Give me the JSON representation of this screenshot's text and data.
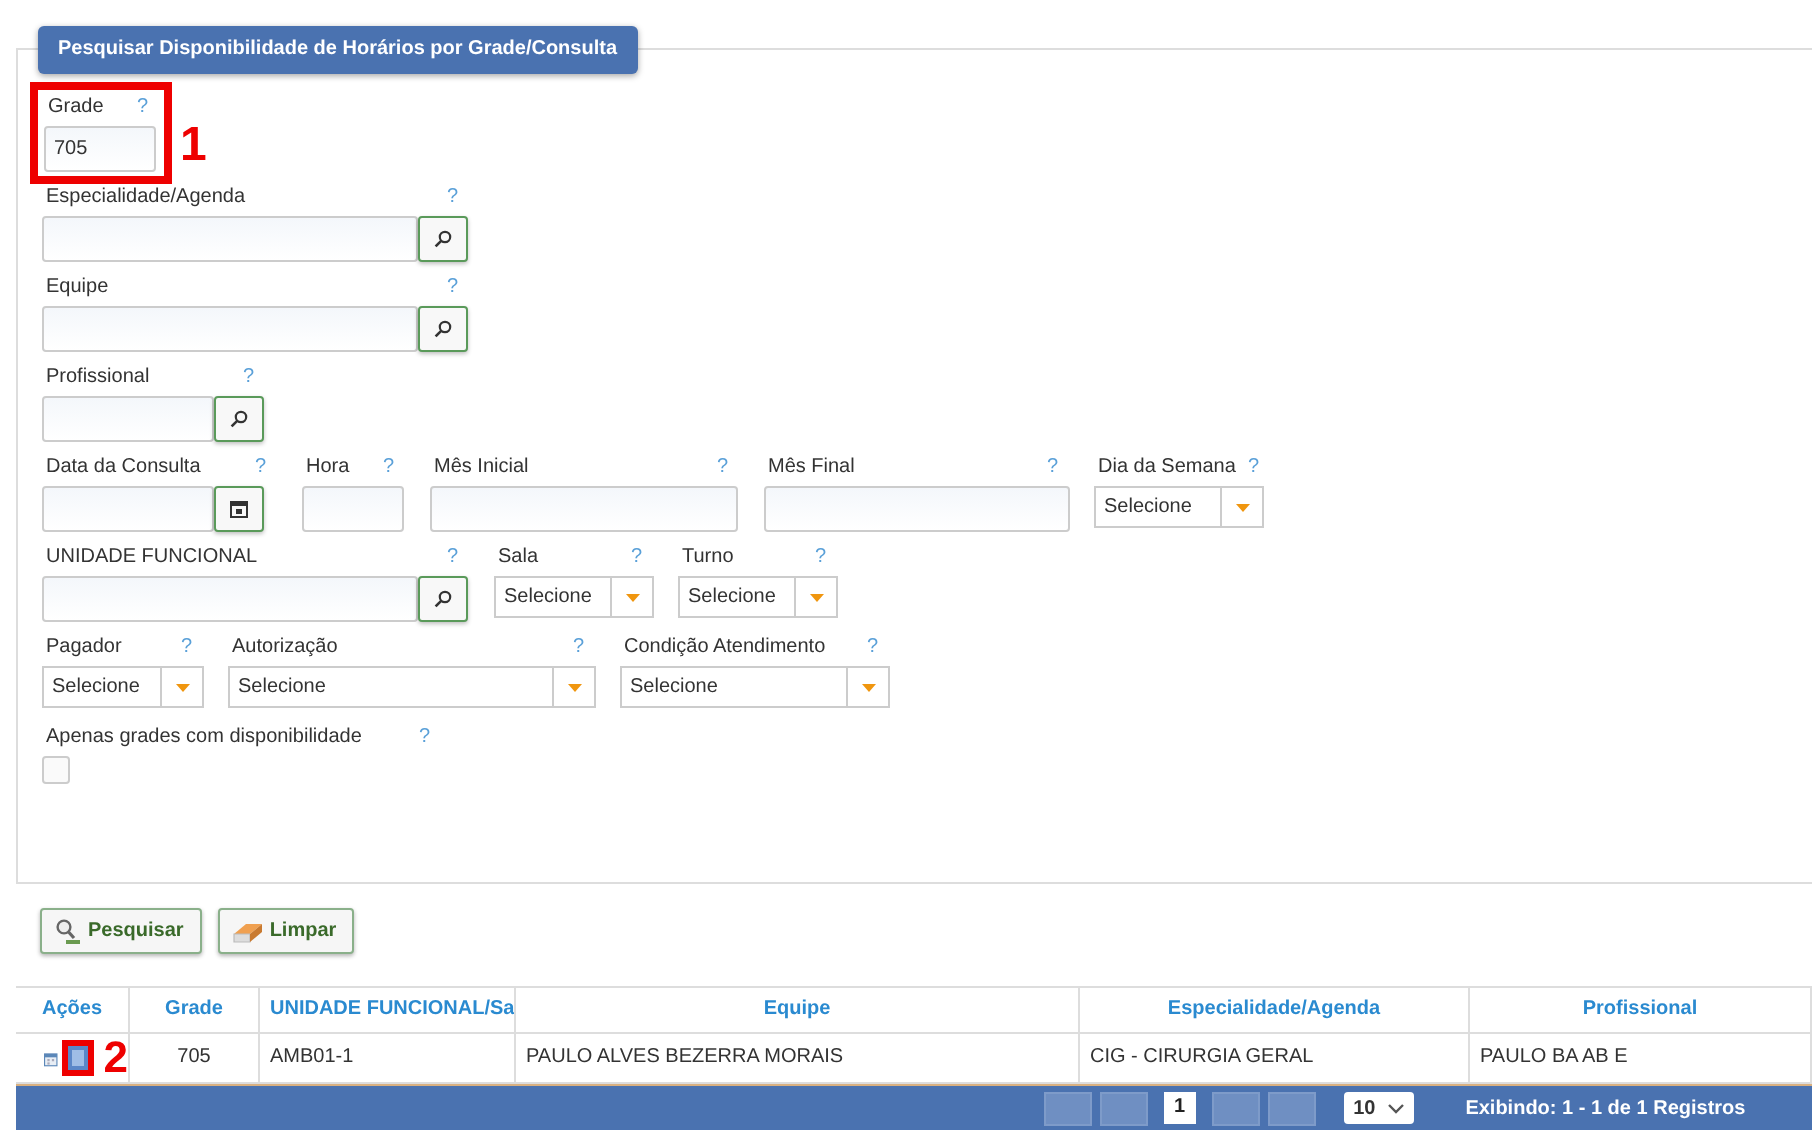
{
  "panel": {
    "title": "Pesquisar Disponibilidade de Horários por Grade/Consulta"
  },
  "annotations": [
    {
      "label": "1"
    },
    {
      "label": "2"
    }
  ],
  "form_rows": [
    [
      {
        "label": "Grade",
        "help": "?",
        "kind": "text",
        "value": "705"
      }
    ],
    [
      {
        "label": "Especialidade/Agenda",
        "help": "?",
        "kind": "lookup"
      }
    ],
    [
      {
        "label": "Equipe",
        "help": "?",
        "kind": "lookup"
      }
    ],
    [
      {
        "label": "Profissional",
        "help": "?",
        "kind": "lookup"
      }
    ],
    [
      {
        "label": "Data da Consulta",
        "help": "?",
        "kind": "date"
      },
      {
        "label": "Hora",
        "help": "?",
        "kind": "text"
      },
      {
        "label": "Mês Inicial",
        "help": "?",
        "kind": "text"
      },
      {
        "label": "Mês Final",
        "help": "?",
        "kind": "text"
      },
      {
        "label": "Dia da Semana",
        "help": "?",
        "kind": "select",
        "value": "Selecione"
      }
    ],
    [
      {
        "label": "UNIDADE FUNCIONAL",
        "help": "?",
        "kind": "lookup"
      },
      {
        "label": "Sala",
        "help": "?",
        "kind": "select",
        "value": "Selecione"
      },
      {
        "label": "Turno",
        "help": "?",
        "kind": "select",
        "value": "Selecione"
      }
    ],
    [
      {
        "label": "Pagador",
        "help": "?",
        "kind": "select",
        "value": "Selecione"
      },
      {
        "label": "Autorização",
        "help": "?",
        "kind": "select",
        "value": "Selecione"
      },
      {
        "label": "Condição Atendimento",
        "help": "?",
        "kind": "select",
        "value": "Selecione"
      }
    ],
    [
      {
        "label": "Apenas grades com disponibilidade",
        "help": "?",
        "kind": "checkbox",
        "checked": false
      }
    ]
  ],
  "buttons": [
    {
      "label": "Pesquisar",
      "kind": "search"
    },
    {
      "label": "Limpar",
      "kind": "clear"
    }
  ],
  "table": {
    "columns": [
      "Ações",
      "Grade",
      "UNIDADE FUNCIONAL/Sa",
      "Equipe",
      "Especialidade/Agenda",
      "Profissional"
    ],
    "rows": [
      {
        "cells": [
          "",
          "705",
          "AMB01-1",
          "PAULO ALVES BEZERRA MORAIS",
          "CIG - CIRURGIA GERAL",
          "PAULO BA AB E"
        ]
      }
    ]
  },
  "pager": {
    "page": "1",
    "page_size": "10",
    "summary": "Exibindo: 1 - 1 de 1 Registros"
  }
}
